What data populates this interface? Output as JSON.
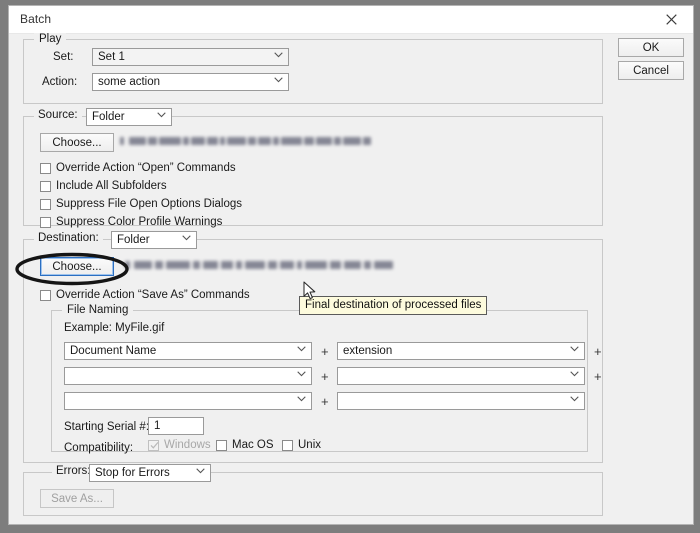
{
  "window": {
    "title": "Batch",
    "close_icon": "close-icon"
  },
  "buttons": {
    "ok": "OK",
    "cancel": "Cancel"
  },
  "play": {
    "legend": "Play",
    "set_label": "Set:",
    "set_value": "Set 1",
    "action_label": "Action:",
    "action_value": "some action"
  },
  "source": {
    "legend_label": "Source:",
    "value": "Folder",
    "choose_label": "Choose...",
    "path_redacted": true,
    "checkboxes": [
      {
        "label": "Override Action “Open” Commands",
        "checked": false,
        "disabled": false
      },
      {
        "label": "Include All Subfolders",
        "checked": false,
        "disabled": false
      },
      {
        "label": "Suppress File Open Options Dialogs",
        "checked": false,
        "disabled": false
      },
      {
        "label": "Suppress Color Profile Warnings",
        "checked": false,
        "disabled": false
      }
    ]
  },
  "destination": {
    "legend_label": "Destination:",
    "value": "Folder",
    "choose_label": "Choose...",
    "path_redacted": true,
    "override_checkbox": {
      "label": "Override Action “Save As” Commands",
      "checked": false
    }
  },
  "file_naming": {
    "legend": "File Naming",
    "example_label": "Example: MyFile.gif",
    "rows": [
      {
        "left": "Document Name",
        "right": "extension",
        "plus": "+",
        "trailing_plus": "+"
      },
      {
        "left": "",
        "right": "",
        "plus": "+",
        "trailing_plus": "+"
      },
      {
        "left": "",
        "right": "",
        "plus": "+",
        "trailing_plus": ""
      }
    ],
    "serial_label": "Starting Serial #:",
    "serial_value": "1",
    "compatibility_label": "Compatibility:",
    "compatibility": [
      {
        "label": "Windows",
        "checked": true,
        "disabled": true
      },
      {
        "label": "Mac OS",
        "checked": false,
        "disabled": false
      },
      {
        "label": "Unix",
        "checked": false,
        "disabled": false
      }
    ]
  },
  "errors": {
    "label": "Errors:",
    "value": "Stop for Errors",
    "save_as_label": "Save As...",
    "save_as_disabled": true
  },
  "tooltip": {
    "text": "Final destination of processed files"
  },
  "annotation": {
    "type": "ellipse-highlight",
    "target": "destination-choose-button",
    "color": "#151515"
  },
  "colors": {
    "desktop": "#7d7d7d",
    "dialog": "#f0f0f0",
    "titlebar": "#ffffff",
    "tooltip_bg": "#fdfbdd",
    "focus_border": "#2b6fc2"
  }
}
